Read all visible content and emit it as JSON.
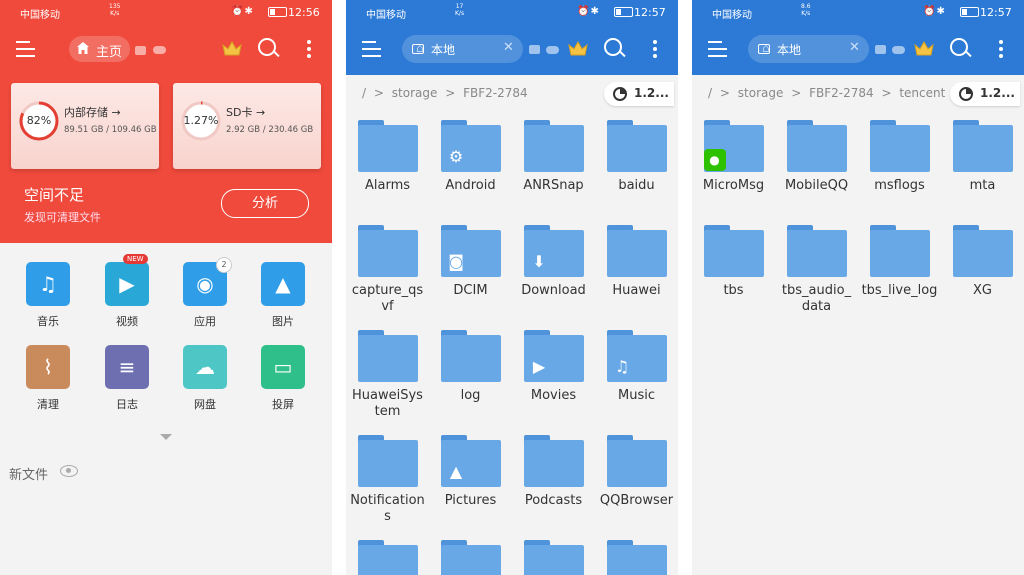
{
  "status": {
    "carrier": "中国移动",
    "panel1_speed": [
      "135",
      "K/s"
    ],
    "panel2_speed": [
      "17",
      "K/s"
    ],
    "panel3_speed": [
      "8.6",
      "K/s"
    ],
    "panel1_time": "12:56",
    "panel2_time": "12:57",
    "panel3_time": "12:57"
  },
  "home": {
    "tab_label": "主页",
    "storage_cards": [
      {
        "title": "内部存储 →",
        "percent": "82%",
        "percent_value": 82,
        "usage": "89.51 GB / 109.46 GB"
      },
      {
        "title": "SD卡 →",
        "percent": "1.27%",
        "percent_value": 1.27,
        "usage": "2.92 GB / 230.46 GB"
      }
    ],
    "space_title": "空间不足",
    "space_sub": "发现可清理文件",
    "analyze_label": "分析",
    "categories": [
      {
        "label": "音乐",
        "icon": "music-icon",
        "color": "#2f9de8"
      },
      {
        "label": "视频",
        "icon": "video-icon",
        "color": "#29a8d8",
        "badge": "NEW"
      },
      {
        "label": "应用",
        "icon": "android-icon",
        "color": "#2f9de8",
        "badge": "2"
      },
      {
        "label": "图片",
        "icon": "image-icon",
        "color": "#2f9de8"
      },
      {
        "label": "清理",
        "icon": "broom-icon",
        "color": "#c98a5c"
      },
      {
        "label": "日志",
        "icon": "log-icon",
        "color": "#6d6fb0"
      },
      {
        "label": "网盘",
        "icon": "cloud-icon",
        "color": "#4fc6c6"
      },
      {
        "label": "投屏",
        "icon": "cast-icon",
        "color": "#2fbf8a"
      }
    ],
    "new_files_label": "新文件"
  },
  "browser": {
    "tab_label": "本地",
    "close_glyph": "✕",
    "usage_label": "1.2...",
    "root_glyph": "/",
    "sep_glyph": ">"
  },
  "storage_view": {
    "breadcrumb": [
      "storage",
      "FBF2-2784"
    ],
    "folders": [
      {
        "name": "Alarms"
      },
      {
        "name": "Android",
        "emblem": "gear-icon"
      },
      {
        "name": "ANRSnap"
      },
      {
        "name": "baidu"
      },
      {
        "name": "capture_qs\nvf"
      },
      {
        "name": "DCIM",
        "emblem": "camera-icon"
      },
      {
        "name": "Download",
        "emblem": "download-icon"
      },
      {
        "name": "Huawei"
      },
      {
        "name": "HuaweiSys\ntem"
      },
      {
        "name": "log"
      },
      {
        "name": "Movies",
        "emblem": "play-icon"
      },
      {
        "name": "Music",
        "emblem": "note-icon"
      },
      {
        "name": "Notification\ns"
      },
      {
        "name": "Pictures",
        "emblem": "picture-icon"
      },
      {
        "name": "Podcasts"
      },
      {
        "name": "QQBrowser"
      },
      {
        "name": ""
      },
      {
        "name": ""
      },
      {
        "name": ""
      },
      {
        "name": ""
      }
    ]
  },
  "tencent_view": {
    "breadcrumb": [
      "storage",
      "FBF2-2784",
      "tencent"
    ],
    "folders": [
      {
        "name": "MicroMsg",
        "emblem": "wechat-icon"
      },
      {
        "name": "MobileQQ"
      },
      {
        "name": "msflogs"
      },
      {
        "name": "mta"
      },
      {
        "name": "tbs"
      },
      {
        "name": "tbs_audio_\ndata"
      },
      {
        "name": "tbs_live_log"
      },
      {
        "name": "XG"
      }
    ]
  },
  "colors": {
    "home_red": "#ef4a3c",
    "browser_blue": "#2c7ad6",
    "folder_blue": "#69a8e6"
  }
}
